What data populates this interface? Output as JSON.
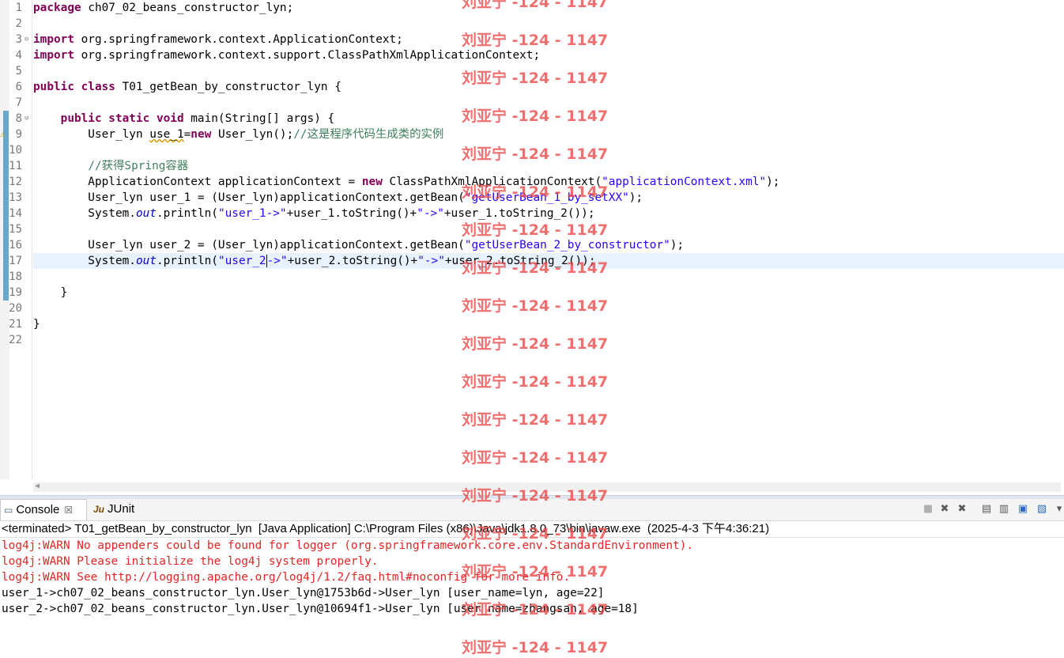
{
  "editor": {
    "line_numbers": [
      "1",
      "2",
      "3",
      "4",
      "5",
      "6",
      "7",
      "8",
      "9",
      "10",
      "11",
      "12",
      "13",
      "14",
      "15",
      "16",
      "17",
      "18",
      "19",
      "20",
      "21",
      "22"
    ],
    "code": {
      "l1_kw": "package",
      "l1_rest": " ch07_02_beans_constructor_lyn;",
      "l3_kw": "import",
      "l3_rest": " org.springframework.context.ApplicationContext;",
      "l4_kw": "import",
      "l4_rest": " org.springframework.context.support.ClassPathXmlApplicationContext;",
      "l6_kw": "public class",
      "l6_rest": " T01_getBean_by_constructor_lyn {",
      "l8_indent": "    ",
      "l8_kw": "public static void",
      "l8_rest": " main(String[] args) {",
      "l9_a": "        User_lyn ",
      "l9_var": "use_1",
      "l9_b": "=",
      "l9_kw": "new",
      "l9_c": " User_lyn();",
      "l9_comment": "//这是程序代码生成类的实例",
      "l11_indent": "        ",
      "l11_comment": "//获得Spring容器",
      "l12_a": "        ApplicationContext applicationContext = ",
      "l12_kw": "new",
      "l12_b": " ClassPathXmlApplicationContext(",
      "l12_str": "\"applicationContext.xml\"",
      "l12_c": ");",
      "l13_a": "        User_lyn user_1 = (User_lyn)applicationContext.getBean(",
      "l13_str": "\"getUserBean_1_by_setXX\"",
      "l13_c": ");",
      "l14_a": "        System.",
      "l14_it": "out",
      "l14_b": ".println(",
      "l14_s1": "\"user_1->\"",
      "l14_c": "+user_1.toString()+",
      "l14_s2": "\"->\"",
      "l14_d": "+user_1.toString_2());",
      "l16_a": "        User_lyn user_2 = (User_lyn)applicationContext.getBean(",
      "l16_str": "\"getUserBean_2_by_constructor\"",
      "l16_c": ");",
      "l17_a": "        System.",
      "l17_it": "out",
      "l17_b": ".println(",
      "l17_s1a": "\"user_2",
      "l17_s1b": "->\"",
      "l17_c": "+user_2.toString()+",
      "l17_s2": "\"->\"",
      "l17_d": "+user_2.toString_2());",
      "l19": "    }",
      "l21": "}"
    }
  },
  "console": {
    "tabs": [
      {
        "label": "Console",
        "close": "☒"
      },
      {
        "label": "JUnit",
        "icon": "Ju"
      }
    ],
    "status": "<terminated> T01_getBean_by_constructor_lyn  [Java Application] C:\\Program Files (x86)\\Java\\jdk1.8.0_73\\bin\\javaw.exe  (2025-4-3 下午4:36:21)",
    "lines": [
      "log4j:WARN No appenders could be found for logger (org.springframework.core.env.StandardEnvironment).",
      "log4j:WARN Please initialize the log4j system properly.",
      "log4j:WARN See http://logging.apache.org/log4j/1.2/faq.html#noconfig for more info.",
      "user_1->ch07_02_beans_constructor_lyn.User_lyn@1753b6d->User_lyn [user_name=lyn, age=22]",
      "user_2->ch07_02_beans_constructor_lyn.User_lyn@10694f1->User_lyn [user_name=zhangsan, age=18]"
    ]
  },
  "watermark": "刘亚宁 -124 - 1147",
  "colors": {
    "keyword": "#7f0055",
    "string": "#2a00ff",
    "comment": "#3f7f5f",
    "field": "#0000c0",
    "error_output": "#e32525",
    "current_line": "#e8f2fe",
    "watermark": "#eb4646"
  }
}
